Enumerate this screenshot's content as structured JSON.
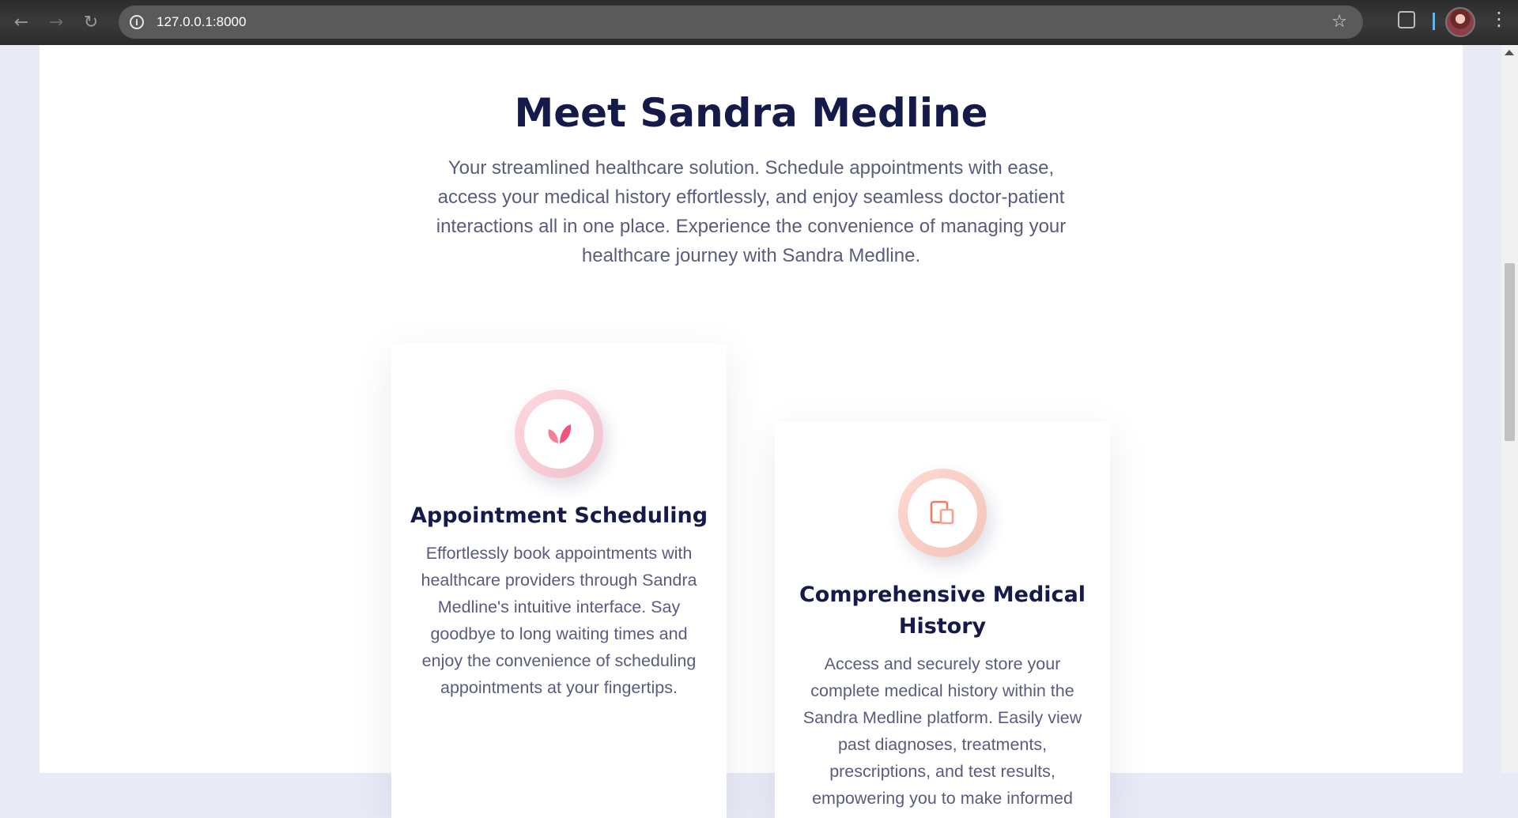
{
  "browser": {
    "url": "127.0.0.1:8000",
    "back_icon": "arrow-left-icon",
    "forward_icon": "arrow-right-icon",
    "reload_icon": "reload-icon"
  },
  "hero": {
    "title": "Meet Sandra Medline",
    "description": "Your streamlined healthcare solution. Schedule appointments with ease, access your medical history effortlessly, and enjoy seamless doctor-patient interactions all in one place. Experience the convenience of managing your healthcare journey with Sandra Medline."
  },
  "features": [
    {
      "icon": "leaf-icon",
      "title": "Appointment Scheduling",
      "text": "Effortlessly book appointments with healthcare providers through Sandra Medline's intuitive interface. Say goodbye to long waiting times and enjoy the convenience of scheduling appointments at your fingertips."
    },
    {
      "icon": "devices-icon",
      "title": "Comprehensive Medical History",
      "text": "Access and securely store your complete medical history within the Sandra Medline platform. Easily view past diagnoses, treatments, prescriptions, and test results, empowering you to make informed"
    }
  ],
  "colors": {
    "heading": "#151a4a",
    "body_text": "#5a5c7e",
    "leaf_accent": "#f0567a",
    "device_accent": "#f47a5e"
  }
}
